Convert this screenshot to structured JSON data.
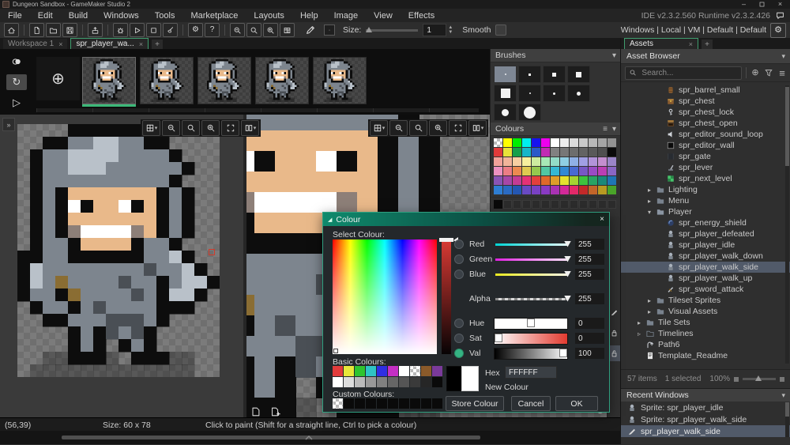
{
  "window": {
    "title": "Dungeon Sandbox - GameMaker Studio 2",
    "version": "IDE v2.3.2.560  Runtime v2.3.2.426",
    "controls": [
      "minimize",
      "maximize",
      "close"
    ]
  },
  "menu": {
    "items": [
      "File",
      "Edit",
      "Build",
      "Windows",
      "Tools",
      "Marketplace",
      "Layouts",
      "Help",
      "Image",
      "View",
      "Effects"
    ]
  },
  "toolbar": {
    "buttons": [
      "home",
      "|",
      "new-file",
      "open",
      "save",
      "|",
      "export",
      "|",
      "debug",
      "play",
      "stop",
      "clean",
      "|",
      "settings",
      "help",
      "|",
      "zoom-out",
      "zoom-reset",
      "zoom-in",
      "room"
    ],
    "tool_icon": "pencil",
    "brush_preview": "·",
    "size_label": "Size:",
    "size_value": "1",
    "smooth_label": "Smooth",
    "targets": "Windows | Local | VM | Default | Default"
  },
  "tabs": {
    "workspace": [
      {
        "label": "Workspace 1",
        "active": false
      },
      {
        "label": "spr_player_wa...",
        "active": true
      }
    ],
    "plus": "+",
    "assets": [
      {
        "label": "Assets",
        "active": true
      }
    ]
  },
  "frame_strip": {
    "side_buttons": [
      {
        "icon": "onion",
        "selected": false
      },
      {
        "icon": "loop",
        "selected": true
      },
      {
        "icon": "play-outline",
        "selected": false
      }
    ],
    "add_label": "+",
    "frames": [
      {
        "selected": true
      },
      {
        "selected": false
      },
      {
        "selected": false
      },
      {
        "selected": false
      },
      {
        "selected": false
      }
    ]
  },
  "canvas": {
    "toolbar": [
      {
        "icon": "grid4",
        "caret": "▾"
      },
      {
        "icon": "zoom-out",
        "caret": ""
      },
      {
        "icon": "zoom-reset",
        "caret": ""
      },
      {
        "icon": "zoom-in",
        "caret": ""
      },
      {
        "icon": "fit",
        "caret": ""
      },
      {
        "icon": "split",
        "caret": "▾"
      }
    ],
    "expand_glyph": "»",
    "cursor_color": "#d23a2a"
  },
  "sprite": {
    "palette": {
      "k": "#0d0d0d",
      "d": "#4a4f55",
      "g": "#7d858e",
      "l": "#b9c1c9",
      "w": "#ffffff",
      "s": "#e9b98a",
      "m": "#8d7f78",
      "b": "#8a6d33",
      "h": "rgba(0,0,0,0.28)"
    },
    "rows": [
      "....kkkkkk......",
      "..kkggllggkk....",
      ".kggllllggggk...",
      ".kgglllggggggk..",
      ".kggggggggggk...",
      ".kgkssssssskgk..",
      ".kgkwksswkskgk..",
      ".kgkssssssskgk..",
      ".kgkmwwwwmskgk..",
      ".kggksssskggk...",
      "kkggkkkkkkgglk..",
      "klggggggggdgglk.",
      "klgbggggdggkgllk",
      "kggkbggggdgkllk.",
      ".kggkgdggggkkk..",
      "..kkgggdddgk....",
      "....kgkdgdk.....",
      "....kgk.kgk.....",
      "..hhkkkh.kkkhh..",
      ".hhhhhhhhhhhhh.."
    ]
  },
  "brushes_panel": {
    "title": "Brushes",
    "brushes": [
      {
        "shape": "sq1",
        "selected": true
      },
      {
        "shape": "sq2",
        "selected": false
      },
      {
        "shape": "sq3",
        "selected": false
      },
      {
        "shape": "sq4",
        "selected": false
      },
      {
        "shape": "sq5",
        "selected": false
      },
      {
        "shape": "c1",
        "selected": false
      },
      {
        "shape": "c2",
        "selected": false
      },
      {
        "shape": "c3",
        "selected": false
      },
      {
        "shape": "c4",
        "selected": false
      },
      {
        "shape": "c5",
        "selected": false
      }
    ]
  },
  "colours_panel": {
    "title": "Colours",
    "swatches": [
      "checker",
      "#ffff00",
      "#00ee00",
      "#00eeee",
      "#1612ee",
      "#ee00ee",
      "#ffffff",
      "#ededed",
      "#dbdbdb",
      "#c9c9c9",
      "#b7b7b7",
      "#a5a5a5",
      "#939393",
      "#e03a3a",
      "#e8e33a",
      "#16a04a",
      "#18b6c8",
      "#2b59c8",
      "#c02bb4",
      "#818181",
      "#777777",
      "#6d6d6d",
      "#636363",
      "#595959",
      "#4f4f4f",
      "#0a0a0a",
      "#f2a29a",
      "#f2b49a",
      "#f7cfa2",
      "#f7f09e",
      "#cdeb9f",
      "#a7e8b6",
      "#93dcc8",
      "#90cfe4",
      "#8fb0e6",
      "#a19fe4",
      "#b293d9",
      "#c38ecf",
      "#9a85c8",
      "#ec91c0",
      "#ec7d85",
      "#ec8a50",
      "#dfc951",
      "#95c74e",
      "#50c7a3",
      "#34b8d4",
      "#3289d4",
      "#486ad2",
      "#7857c5",
      "#9a4bc5",
      "#bb3eb4",
      "#8a66c4",
      "#8954b4",
      "#a747a7",
      "#c33c94",
      "#e53276",
      "#e33f3c",
      "#df692a",
      "#de9e2a",
      "#e5e22e",
      "#a5d332",
      "#3ec33e",
      "#29a464",
      "#1a8979",
      "#1f76b4",
      "#2e7ed3",
      "#2a6bc3",
      "#2457b3",
      "#694ac3",
      "#7941c3",
      "#893ac3",
      "#a932b3",
      "#d32999",
      "#e32969",
      "#c32929",
      "#c36529",
      "#b89a22",
      "#4aa429"
    ],
    "custom": [
      "#0a0a0a",
      "empty",
      "empty",
      "empty",
      "empty",
      "empty",
      "empty",
      "empty",
      "empty",
      "empty",
      "empty",
      "empty",
      "empty"
    ]
  },
  "colour_dialog": {
    "title": "Colour",
    "title_glyph": "◢",
    "close_glyph": "×",
    "select_label": "Select Colour:",
    "sliders": [
      {
        "label": "Red",
        "value": "255",
        "cls": "thin track-red h-end radio-off"
      },
      {
        "label": "Green",
        "value": "255",
        "cls": "thin track-green h-end radio-off"
      },
      {
        "label": "Blue",
        "value": "255",
        "cls": "thin track-blue h-end radio-off"
      },
      {
        "label": "Alpha",
        "value": "255",
        "cls": "thin track-alpha h-end radio-none gap"
      },
      {
        "label": "Hue",
        "value": "0",
        "cls": "thick track-hue h-mid radio-off gap"
      },
      {
        "label": "Sat",
        "value": "0",
        "cls": "thick track-sat h-start radio-off"
      },
      {
        "label": "Val",
        "value": "100",
        "cls": "thick track-val h-end radio-on"
      }
    ],
    "basic_label": "Basic Colours:",
    "basic": [
      "#e23b3b",
      "#e8e83a",
      "#2fc42f",
      "#2fc4c4",
      "#2f2fe2",
      "#c42fc4",
      "#ffffff",
      "checker-sel",
      "#8a5a2a",
      "#7a3a9a",
      "#ffffff",
      "#dddddd",
      "#bbbbbb",
      "#999999",
      "#808080",
      "#666666",
      "#555555",
      "#3a3a3a",
      "#262626",
      "#0a0a0a"
    ],
    "hex_label": "Hex",
    "hex_value": "FFFFFF",
    "new_label": "New Colour",
    "custom_label": "Custom Colours:",
    "custom": [
      "checker-sel",
      "#0a0a0a",
      "#0a0a0a",
      "#0a0a0a",
      "#0a0a0a",
      "#0a0a0a",
      "#0a0a0a",
      "#0a0a0a",
      "#0a0a0a",
      "#0a0a0a"
    ],
    "buttons": {
      "store": "Store Colour",
      "cancel": "Cancel",
      "ok": "OK"
    }
  },
  "assets_panel": {
    "browser_label": "Asset Browser",
    "search_placeholder": "Search...",
    "tree": [
      {
        "icon": "barrel",
        "label": "spr_barrel_small",
        "indent": 3,
        "arrow": ""
      },
      {
        "icon": "chest",
        "label": "spr_chest",
        "indent": 3,
        "arrow": ""
      },
      {
        "icon": "chest-lock",
        "label": "spr_chest_lock",
        "indent": 3,
        "arrow": ""
      },
      {
        "icon": "chest-open",
        "label": "spr_chest_open",
        "indent": 3,
        "arrow": ""
      },
      {
        "icon": "sound",
        "label": "spr_editor_sound_loop",
        "indent": 3,
        "arrow": ""
      },
      {
        "icon": "wall",
        "label": "spr_editor_wall",
        "indent": 3,
        "arrow": ""
      },
      {
        "icon": "gate",
        "label": "spr_gate",
        "indent": 3,
        "arrow": ""
      },
      {
        "icon": "lever",
        "label": "spr_lever",
        "indent": 3,
        "arrow": ""
      },
      {
        "icon": "next-level",
        "label": "spr_next_level",
        "indent": 3,
        "arrow": ""
      },
      {
        "icon": "folder",
        "label": "Lighting",
        "indent": 2,
        "arrow": "▸"
      },
      {
        "icon": "folder",
        "label": "Menu",
        "indent": 2,
        "arrow": "▸"
      },
      {
        "icon": "folder-open",
        "label": "Player",
        "indent": 2,
        "arrow": "▾"
      },
      {
        "icon": "shield",
        "label": "spr_energy_shield",
        "indent": 3,
        "arrow": ""
      },
      {
        "icon": "knight",
        "label": "spr_player_defeated",
        "indent": 3,
        "arrow": ""
      },
      {
        "icon": "knight",
        "label": "spr_player_idle",
        "indent": 3,
        "arrow": ""
      },
      {
        "icon": "knight",
        "label": "spr_player_walk_down",
        "indent": 3,
        "arrow": ""
      },
      {
        "icon": "knight",
        "label": "spr_player_walk_side",
        "indent": 3,
        "arrow": "",
        "selected": true
      },
      {
        "icon": "knight",
        "label": "spr_player_walk_up",
        "indent": 3,
        "arrow": ""
      },
      {
        "icon": "sword",
        "label": "spr_sword_attack",
        "indent": 3,
        "arrow": ""
      },
      {
        "icon": "folder",
        "label": "Tileset Sprites",
        "indent": 2,
        "arrow": "▸"
      },
      {
        "icon": "folder",
        "label": "Visual Assets",
        "indent": 2,
        "arrow": "▸"
      },
      {
        "icon": "folder",
        "label": "Tile Sets",
        "indent": 1,
        "arrow": "▸"
      },
      {
        "icon": "folder-empty",
        "label": "Timelines",
        "indent": 1,
        "arrow": "▹"
      },
      {
        "icon": "path",
        "label": "Path6",
        "indent": 1,
        "arrow": ""
      },
      {
        "icon": "readme",
        "label": "Template_Readme",
        "indent": 1,
        "arrow": ""
      }
    ],
    "status": {
      "items": "57 items",
      "selected": "1 selected",
      "zoom": "100%"
    },
    "recent": {
      "title": "Recent Windows",
      "items": [
        {
          "icon": "knight",
          "label": "Sprite: spr_player_idle"
        },
        {
          "icon": "knight",
          "label": "Sprite: spr_player_walk_side"
        },
        {
          "icon": "brush",
          "label": "spr_player_walk_side",
          "selected": true
        }
      ]
    }
  },
  "status_bar": {
    "coords": "(56,39)",
    "size": "Size: 60 x 78",
    "hint": "Click to paint (Shift for a straight line, Ctrl to pick a colour)"
  }
}
